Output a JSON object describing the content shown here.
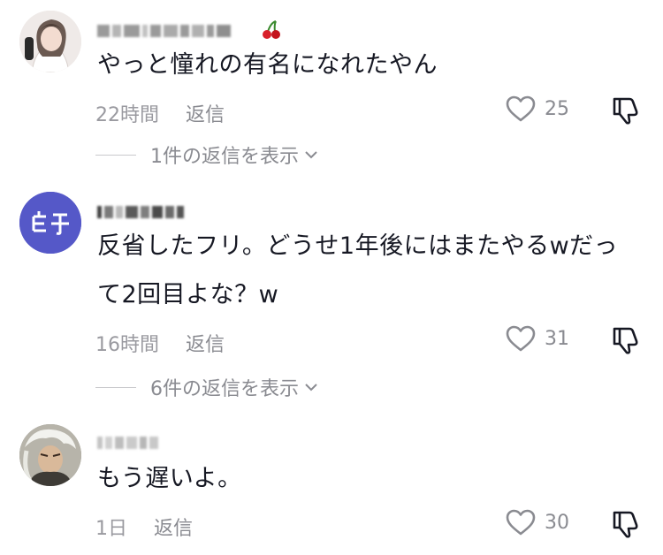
{
  "comments": [
    {
      "text": "やっと憧れの有名になれたやん",
      "time": "22時間",
      "reply_label": "返信",
      "likes": "25",
      "view_replies": "1件の返信を表示",
      "avatar_icon": "anime-girl-avatar",
      "username_badge": "cherry-emoji"
    },
    {
      "text_line1": "反省したフリ。どうせ1年後にはまたやるwだっ",
      "text_line2": "て2回目よな？w",
      "time": "16時間",
      "reply_label": "返信",
      "likes": "31",
      "view_replies": "6件の返信を表示",
      "avatar_icon": "blue-circle-logo-avatar",
      "avatar_color": "#5558c8"
    },
    {
      "text": "もう遅いよ。",
      "time": "1日",
      "reply_label": "返信",
      "likes": "30",
      "avatar_icon": "anime-character-avatar"
    }
  ],
  "colors": {
    "text": "#161823",
    "meta": "#8a8b91",
    "background": "#ffffff"
  }
}
